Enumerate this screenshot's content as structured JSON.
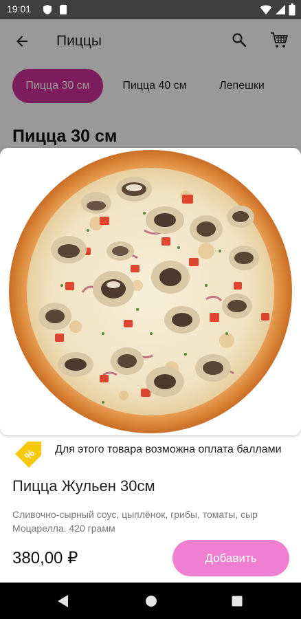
{
  "status_bar": {
    "time": "19:01",
    "icons": [
      "shield-icon",
      "sim-card-icon",
      "wifi-icon",
      "signal-icon",
      "battery-icon"
    ]
  },
  "app_bar": {
    "back_icon": "arrow-back-icon",
    "title": "Пиццы",
    "search_icon": "search-icon",
    "cart_icon": "cart-icon"
  },
  "categories": [
    {
      "label": "Пицца 30 см",
      "active": true
    },
    {
      "label": "Пицца 40 см",
      "active": false
    },
    {
      "label": "Лепешки",
      "active": false
    }
  ],
  "section_title": "Пицца 30 см",
  "product": {
    "image": "mushroom-pizza-image",
    "bonus_icon": "discount-tag-icon",
    "bonus_text": "Для этого товара возможна оплата баллами",
    "name": "Пицца Жульен 30см",
    "description": "Сливочно-сырный соус, цыплёнок, грибы, томаты, сыр Моцарелла. 420 грамм",
    "price": "380,00 ₽",
    "add_button": "Добавить"
  },
  "colors": {
    "accent": "#d2319b",
    "button": "#ef7fd0",
    "status_bar": "#3f3f3f",
    "nav_bar": "#000000"
  },
  "nav_bar": {
    "back_icon": "nav-back-icon",
    "home_icon": "nav-home-icon",
    "recents_icon": "nav-recents-icon"
  }
}
